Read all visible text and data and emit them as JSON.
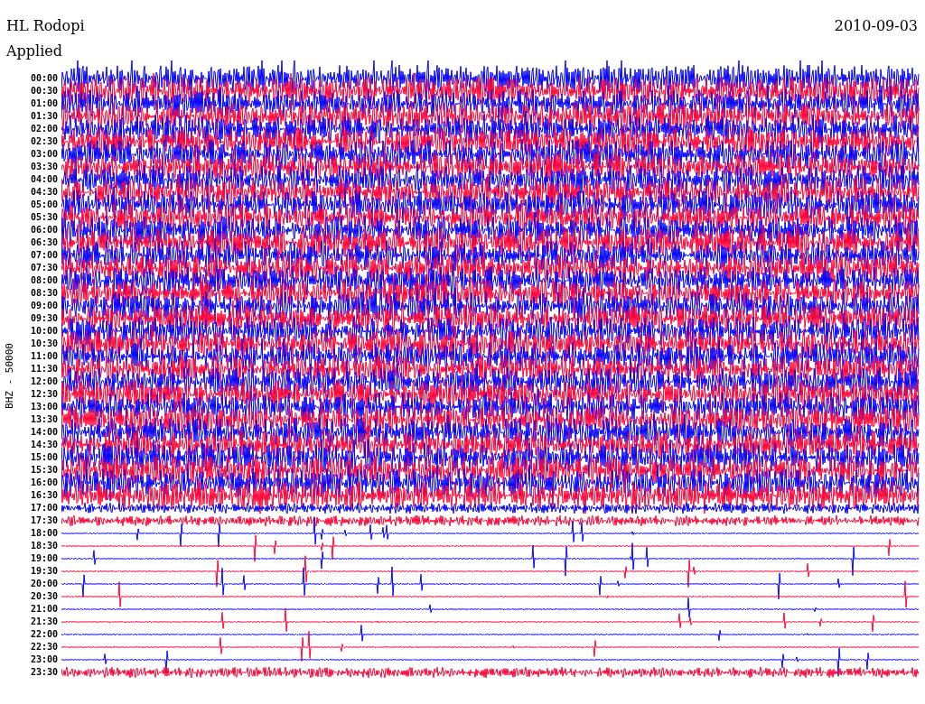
{
  "station": "HL Rodopi",
  "date": "2010-09-03",
  "filter_label": "Applied",
  "channel": "BHZ - 50000",
  "rows": [
    {
      "time": "00:00",
      "color": "#0000ff",
      "kind": "noisy"
    },
    {
      "time": "00:30",
      "color": "#ff0033",
      "kind": "noisy"
    },
    {
      "time": "01:00",
      "color": "#0000ff",
      "kind": "noisy"
    },
    {
      "time": "01:30",
      "color": "#ff0033",
      "kind": "noisy"
    },
    {
      "time": "02:00",
      "color": "#0000ff",
      "kind": "noisy"
    },
    {
      "time": "02:30",
      "color": "#ff0033",
      "kind": "noisy"
    },
    {
      "time": "03:00",
      "color": "#0000ff",
      "kind": "noisy"
    },
    {
      "time": "03:30",
      "color": "#ff0033",
      "kind": "noisy"
    },
    {
      "time": "04:00",
      "color": "#0000ff",
      "kind": "noisy"
    },
    {
      "time": "04:30",
      "color": "#ff0033",
      "kind": "noisy"
    },
    {
      "time": "05:00",
      "color": "#0000ff",
      "kind": "noisy"
    },
    {
      "time": "05:30",
      "color": "#ff0033",
      "kind": "noisy"
    },
    {
      "time": "06:00",
      "color": "#0000ff",
      "kind": "noisy"
    },
    {
      "time": "06:30",
      "color": "#ff0033",
      "kind": "noisy"
    },
    {
      "time": "07:00",
      "color": "#0000ff",
      "kind": "noisy"
    },
    {
      "time": "07:30",
      "color": "#ff0033",
      "kind": "noisy"
    },
    {
      "time": "08:00",
      "color": "#0000ff",
      "kind": "noisy"
    },
    {
      "time": "08:30",
      "color": "#ff0033",
      "kind": "noisy"
    },
    {
      "time": "09:00",
      "color": "#0000ff",
      "kind": "noisy"
    },
    {
      "time": "09:30",
      "color": "#ff0033",
      "kind": "noisy"
    },
    {
      "time": "10:00",
      "color": "#0000ff",
      "kind": "noisy"
    },
    {
      "time": "10:30",
      "color": "#ff0033",
      "kind": "noisy"
    },
    {
      "time": "11:00",
      "color": "#0000ff",
      "kind": "noisy"
    },
    {
      "time": "11:30",
      "color": "#ff0033",
      "kind": "noisy"
    },
    {
      "time": "12:00",
      "color": "#0000ff",
      "kind": "noisy"
    },
    {
      "time": "12:30",
      "color": "#ff0033",
      "kind": "noisy"
    },
    {
      "time": "13:00",
      "color": "#0000ff",
      "kind": "noisy"
    },
    {
      "time": "13:30",
      "color": "#ff0033",
      "kind": "noisy"
    },
    {
      "time": "14:00",
      "color": "#0000ff",
      "kind": "noisy"
    },
    {
      "time": "14:30",
      "color": "#ff0033",
      "kind": "noisy"
    },
    {
      "time": "15:00",
      "color": "#0000ff",
      "kind": "noisy"
    },
    {
      "time": "15:30",
      "color": "#ff0033",
      "kind": "noisy"
    },
    {
      "time": "16:00",
      "color": "#0000ff",
      "kind": "noisy"
    },
    {
      "time": "16:30",
      "color": "#ff0033",
      "kind": "noisy"
    },
    {
      "time": "17:00",
      "color": "#0000ff",
      "kind": "moderate"
    },
    {
      "time": "17:30",
      "color": "#ff0033",
      "kind": "moderate"
    },
    {
      "time": "18:00",
      "color": "#0000ff",
      "kind": "quiet"
    },
    {
      "time": "18:30",
      "color": "#ff0033",
      "kind": "quiet"
    },
    {
      "time": "19:00",
      "color": "#0000ff",
      "kind": "quiet"
    },
    {
      "time": "19:30",
      "color": "#ff0033",
      "kind": "quiet"
    },
    {
      "time": "20:00",
      "color": "#0000ff",
      "kind": "quiet"
    },
    {
      "time": "20:30",
      "color": "#ff0033",
      "kind": "quiet"
    },
    {
      "time": "21:00",
      "color": "#0000ff",
      "kind": "quiet"
    },
    {
      "time": "21:30",
      "color": "#ff0033",
      "kind": "quiet"
    },
    {
      "time": "22:00",
      "color": "#0000ff",
      "kind": "quiet"
    },
    {
      "time": "22:30",
      "color": "#ff0033",
      "kind": "quiet"
    },
    {
      "time": "23:00",
      "color": "#0000ff",
      "kind": "quiet"
    },
    {
      "time": "23:30",
      "color": "#ff0033",
      "kind": "moderate"
    }
  ]
}
